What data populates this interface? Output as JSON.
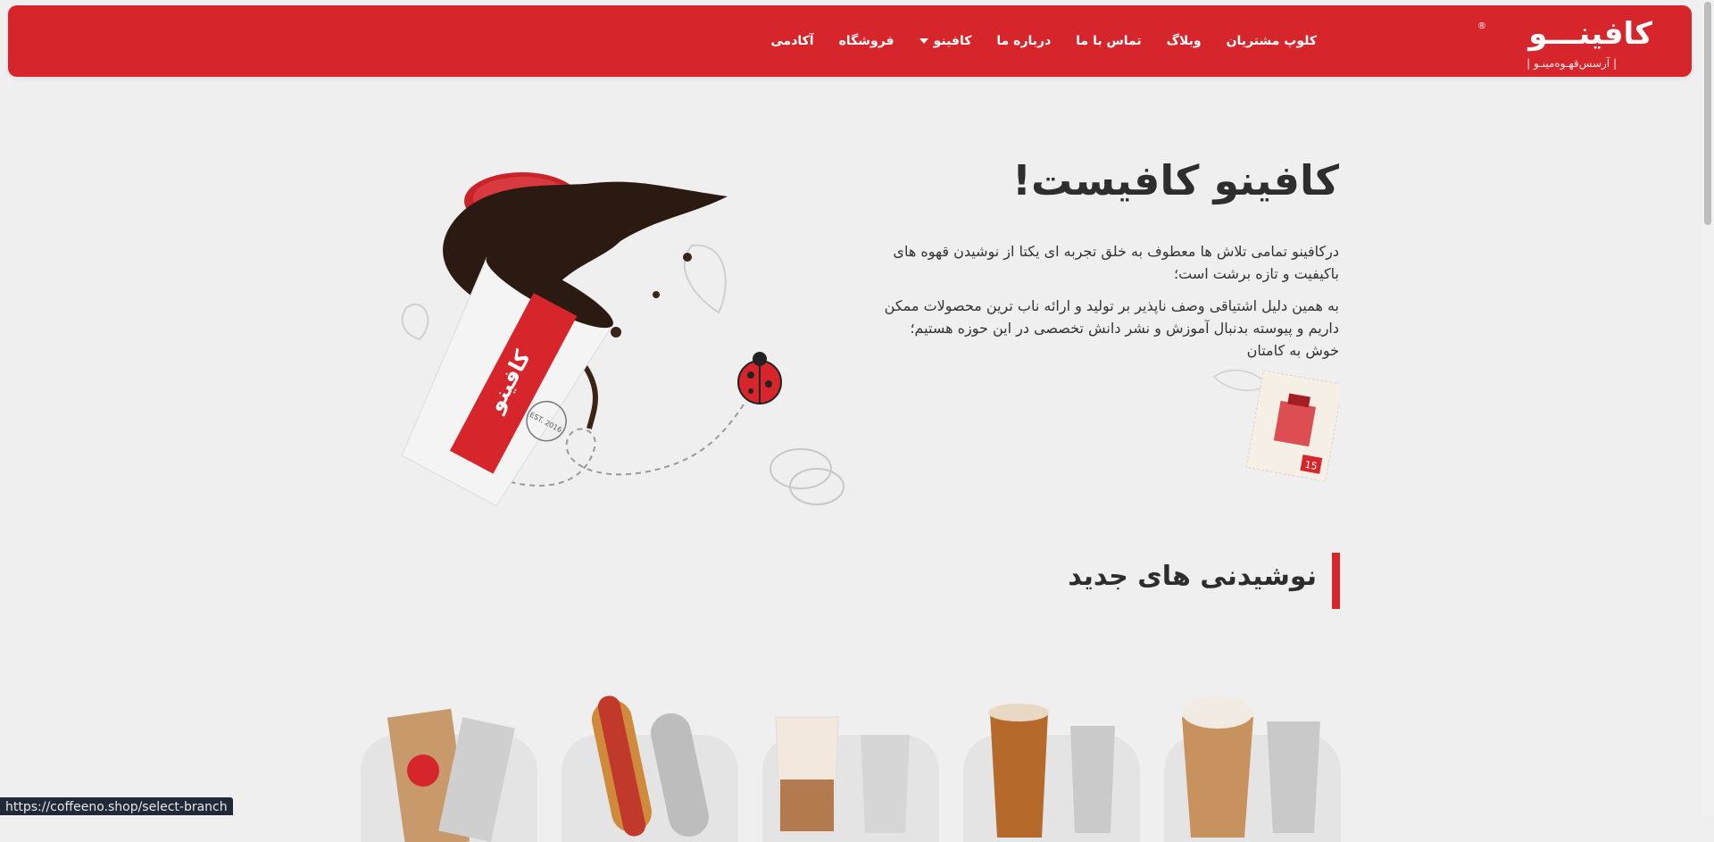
{
  "brand": {
    "logo_text": "کافینـــو",
    "logo_sub": "|  آرسس‌قهـوه‌مینـو  |",
    "registered": "®"
  },
  "nav": {
    "items": [
      {
        "label": "آکادمی"
      },
      {
        "label": "فروشگاه"
      },
      {
        "label": "کافینو",
        "has_dropdown": true
      },
      {
        "label": "درباره ما"
      },
      {
        "label": "تماس با ما"
      },
      {
        "label": "وبلاگ"
      },
      {
        "label": "کلوپ مشتریان"
      }
    ]
  },
  "hero": {
    "title": "کافینو کافیست!",
    "paragraph1": "درکافینو تمامی تلاش ها معطوف به خلق تجربه ای یکتا از نوشیدن قهوه های باکیفیت و تازه برشت است؛",
    "paragraph2": "به همین دلیل اشتیاقی وصف ناپذیر بر تولید و ارائه ناب ترین محصولات ممکن داریم و پیوسته بدنبال آموزش و نشر دانش تخصصی در این حوزه هستیم؛ خوش به کامتان",
    "cup_brand": "کافینو",
    "cup_est": "EST. 2016",
    "stamp_number": "15"
  },
  "section": {
    "title": "نوشیدنی های جدید"
  },
  "products": [
    {
      "name": "coffee-bag"
    },
    {
      "name": "hotdog"
    },
    {
      "name": "latte"
    },
    {
      "name": "iced-caramel"
    },
    {
      "name": "frappe"
    }
  ],
  "status_bar": {
    "url": "https://coffeeno.shop/select-branch"
  },
  "colors": {
    "brand_red": "#d6262c",
    "background": "#efefef"
  }
}
